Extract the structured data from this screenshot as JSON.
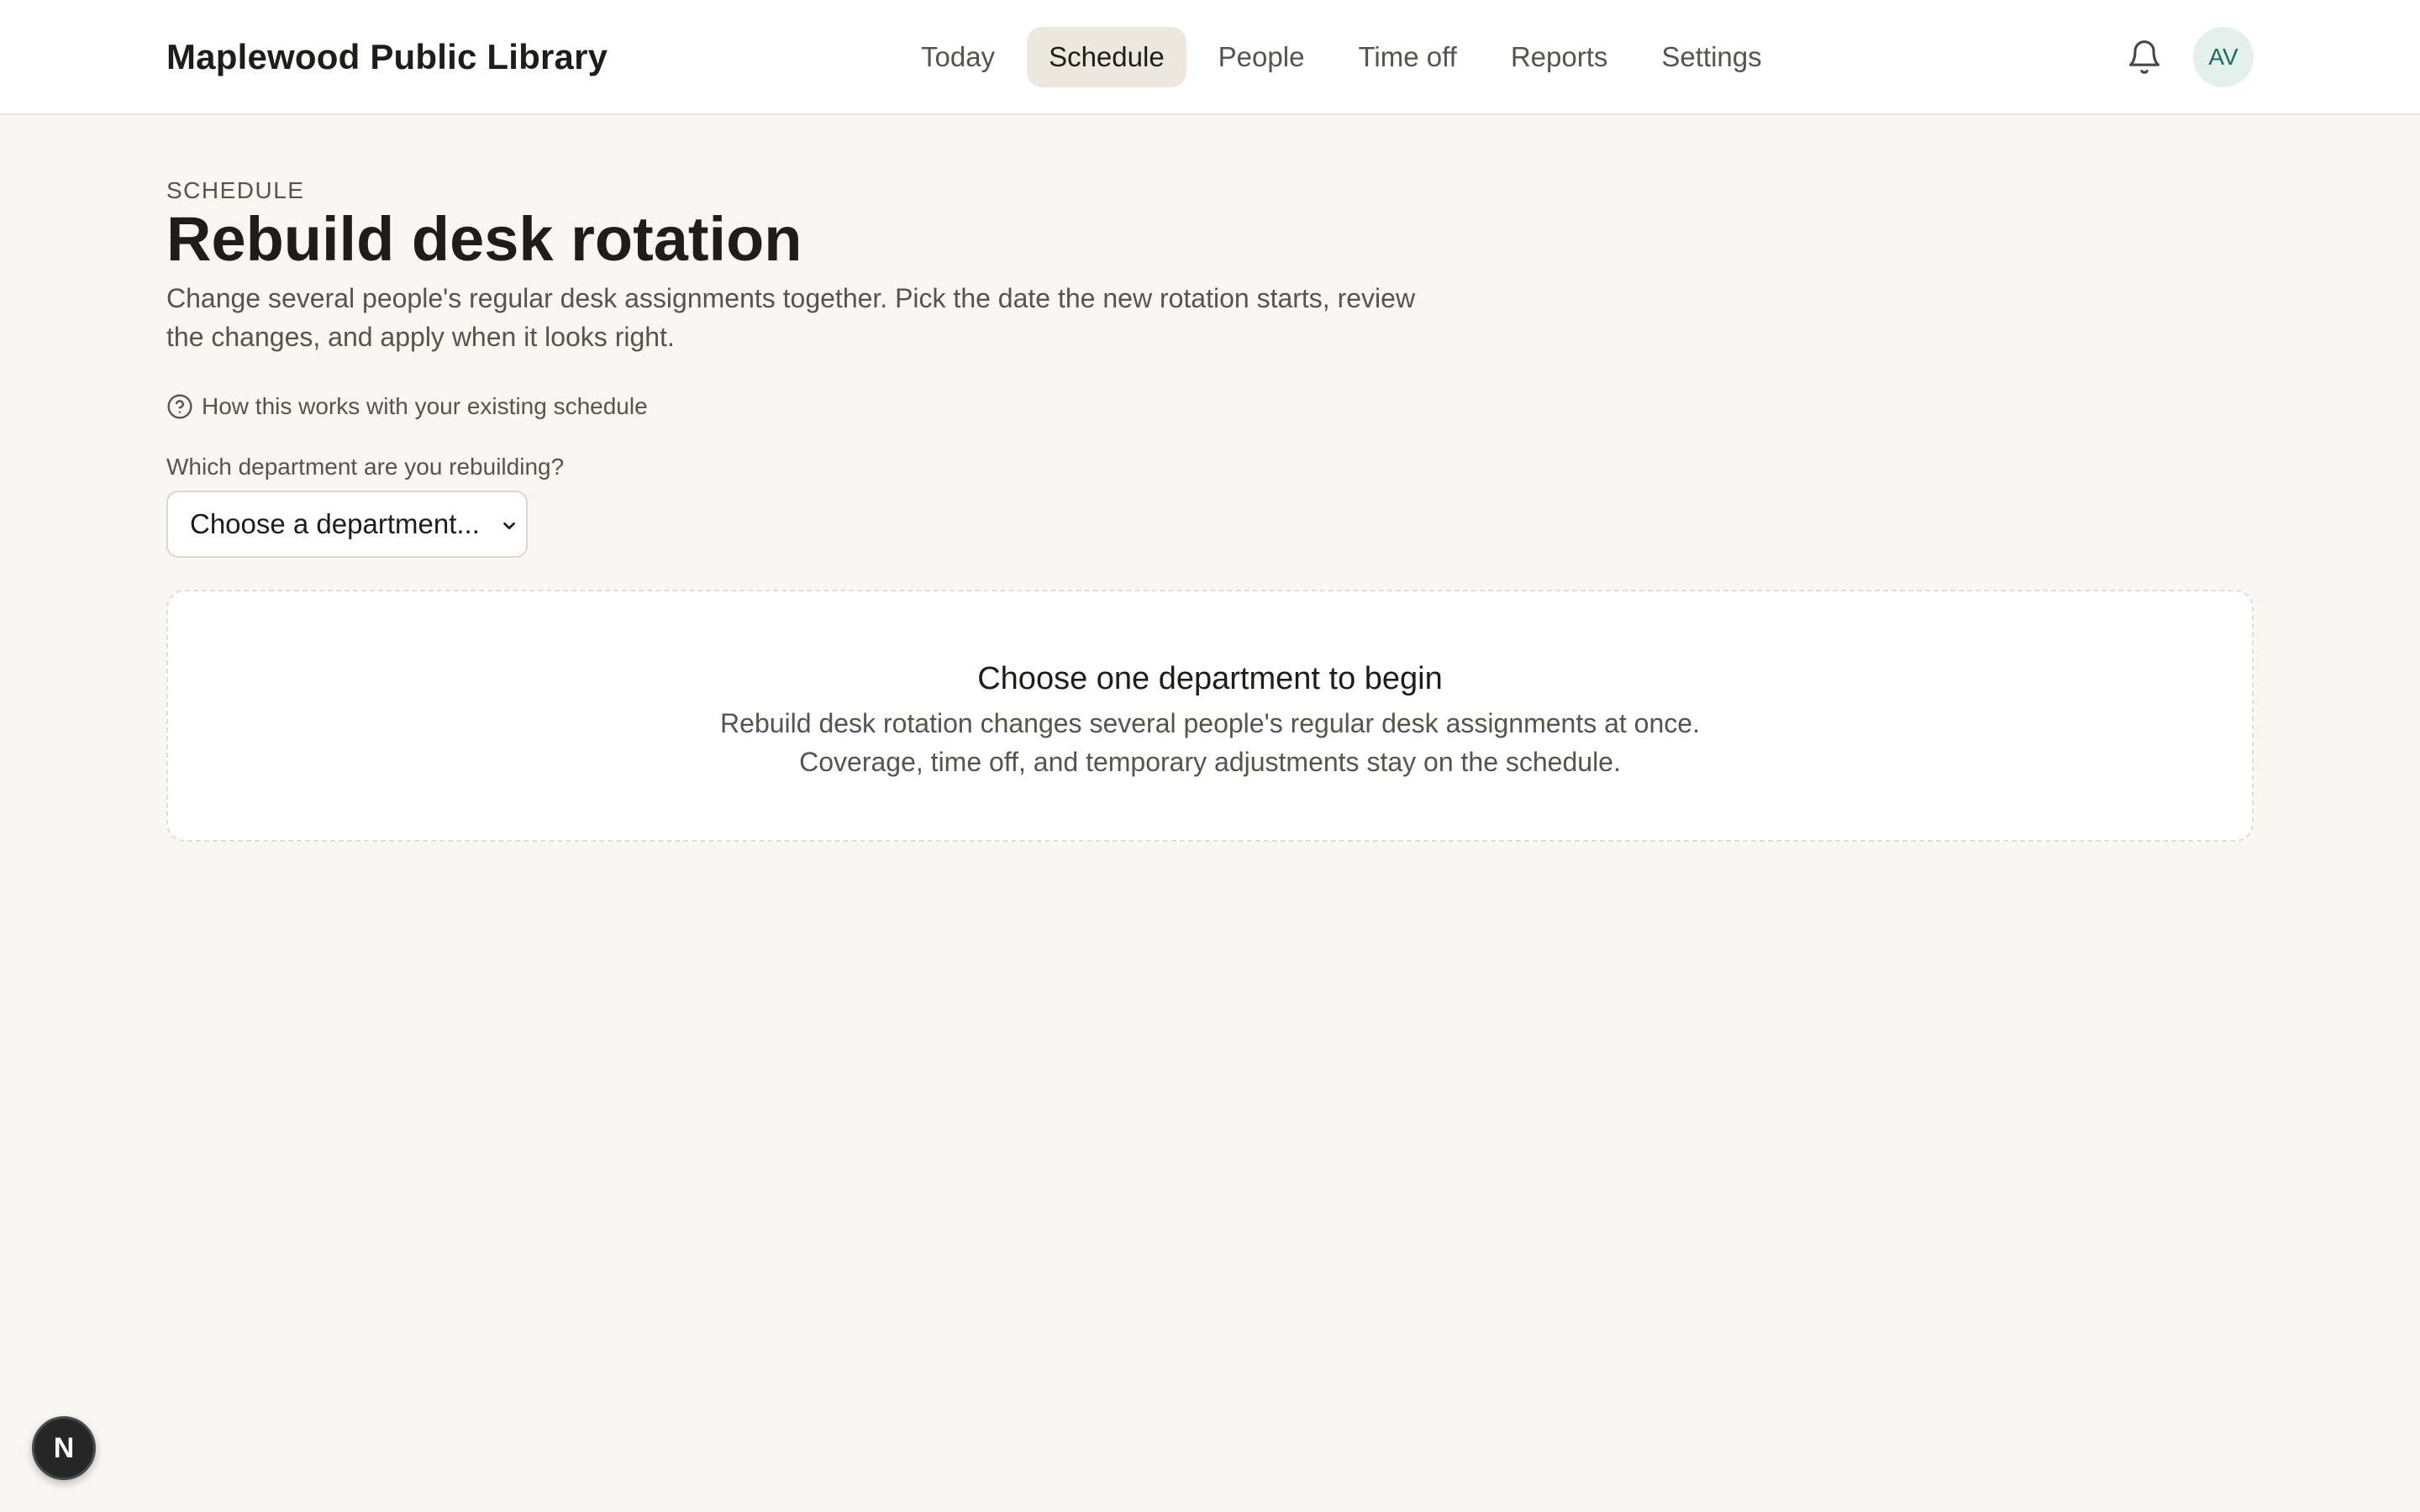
{
  "app": {
    "brand": "Maplewood Public Library",
    "avatar_initials": "AV",
    "accent_color": "#1d6b5a"
  },
  "nav": {
    "items": [
      {
        "label": "Today",
        "active": false
      },
      {
        "label": "Schedule",
        "active": true
      },
      {
        "label": "People",
        "active": false
      },
      {
        "label": "Time off",
        "active": false
      },
      {
        "label": "Reports",
        "active": false
      },
      {
        "label": "Settings",
        "active": false
      }
    ]
  },
  "icons": {
    "notifications": "bell-icon",
    "help": "question-circle-icon",
    "select_chevron": "chevron-down-icon",
    "dev_badge": "N"
  },
  "page": {
    "eyebrow": "SCHEDULE",
    "title": "Rebuild desk rotation",
    "description": "Change several people's regular desk assignments together. Pick the date the new rotation starts, review the changes, and apply when it looks right.",
    "help_link": "How this works with your existing schedule"
  },
  "department_select": {
    "label": "Which department are you rebuilding?",
    "value": "Choose a department..."
  },
  "empty_state": {
    "title": "Choose one department to begin",
    "text": "Rebuild desk rotation changes several people's regular desk assignments at once. Coverage, time off, and temporary adjustments stay on the schedule."
  }
}
